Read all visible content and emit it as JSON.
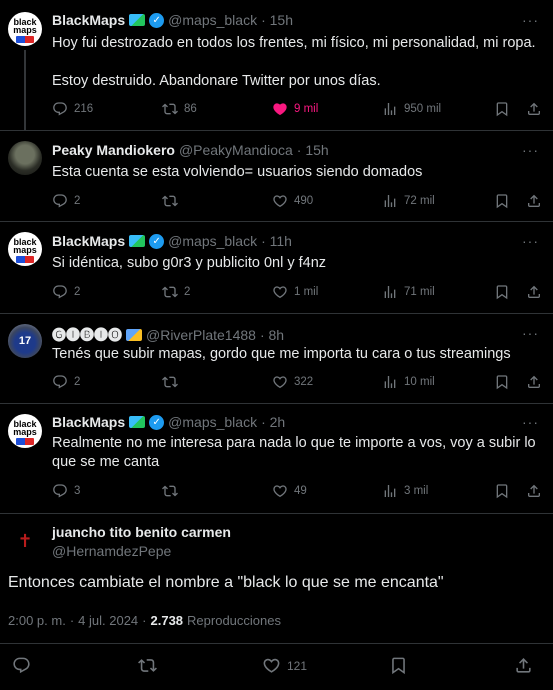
{
  "tweets": [
    {
      "name": "BlackMaps",
      "handle": "@maps_black",
      "time": "· 15h",
      "text_lines": [
        "Hoy fui destrozado en todos los frentes, mi físico, mi personalidad, mi ropa.",
        "",
        "Estoy destruido. Abandonare Twitter por unos días."
      ],
      "replies": "216",
      "retweets": "86",
      "likes": "9 mil",
      "views": "950 mil"
    },
    {
      "name": "Peaky Mandiokero",
      "handle": "@PeakyMandioca",
      "time": "· 15h",
      "text_lines": [
        "Esta cuenta se esta volviendo= usuarios siendo domados"
      ],
      "replies": "2",
      "retweets": "",
      "likes": "490",
      "views": "72 mil"
    },
    {
      "name": "BlackMaps",
      "handle": "@maps_black",
      "time": "· 11h",
      "text_lines": [
        "Si idéntica, subo g0r3 y publicito 0nl y f4nz"
      ],
      "replies": "2",
      "retweets": "2",
      "likes": "1 mil",
      "views": "71 mil"
    },
    {
      "name": "🅖🅘🅑🅘🅞",
      "handle": "@RiverPlate1488",
      "time": "· 8h",
      "text_lines": [
        "Tenés que subir mapas, gordo que me importa tu cara o tus streamings"
      ],
      "replies": "2",
      "retweets": "",
      "likes": "322",
      "views": "10 mil"
    },
    {
      "name": "BlackMaps",
      "handle": "@maps_black",
      "time": "· 2h",
      "text_lines": [
        "Realmente no me interesa para nada lo que te importe a vos, voy a subir lo",
        "que se me canta"
      ],
      "replies": "3",
      "retweets": "",
      "likes": "49",
      "views": "3 mil"
    }
  ],
  "main_tweet": {
    "name": "juancho tito benito carmen",
    "handle": "@HernamdezPepe",
    "text": "Entonces cambiate el nombre a \"black lo que se me encanta\"",
    "time": "2:00 p. m.",
    "date": "4 jul. 2024",
    "separator": "·",
    "views_count": "2.738",
    "views_label": "Reproducciones",
    "likes": "121"
  },
  "avatars": {
    "blackmaps_line1": "black",
    "blackmaps_line2": "maps",
    "river_text": "17"
  },
  "more_glyph": "···",
  "colors": {
    "background": "#000000",
    "text": "#e7e9ea",
    "muted": "#71767b",
    "like_active": "#f91880",
    "verified": "#1d9bf0",
    "divider": "#2f3336"
  },
  "icons": [
    "reply-icon",
    "retweet-icon",
    "like-icon",
    "views-icon",
    "bookmark-icon",
    "share-icon",
    "verified-icon",
    "more-icon"
  ]
}
